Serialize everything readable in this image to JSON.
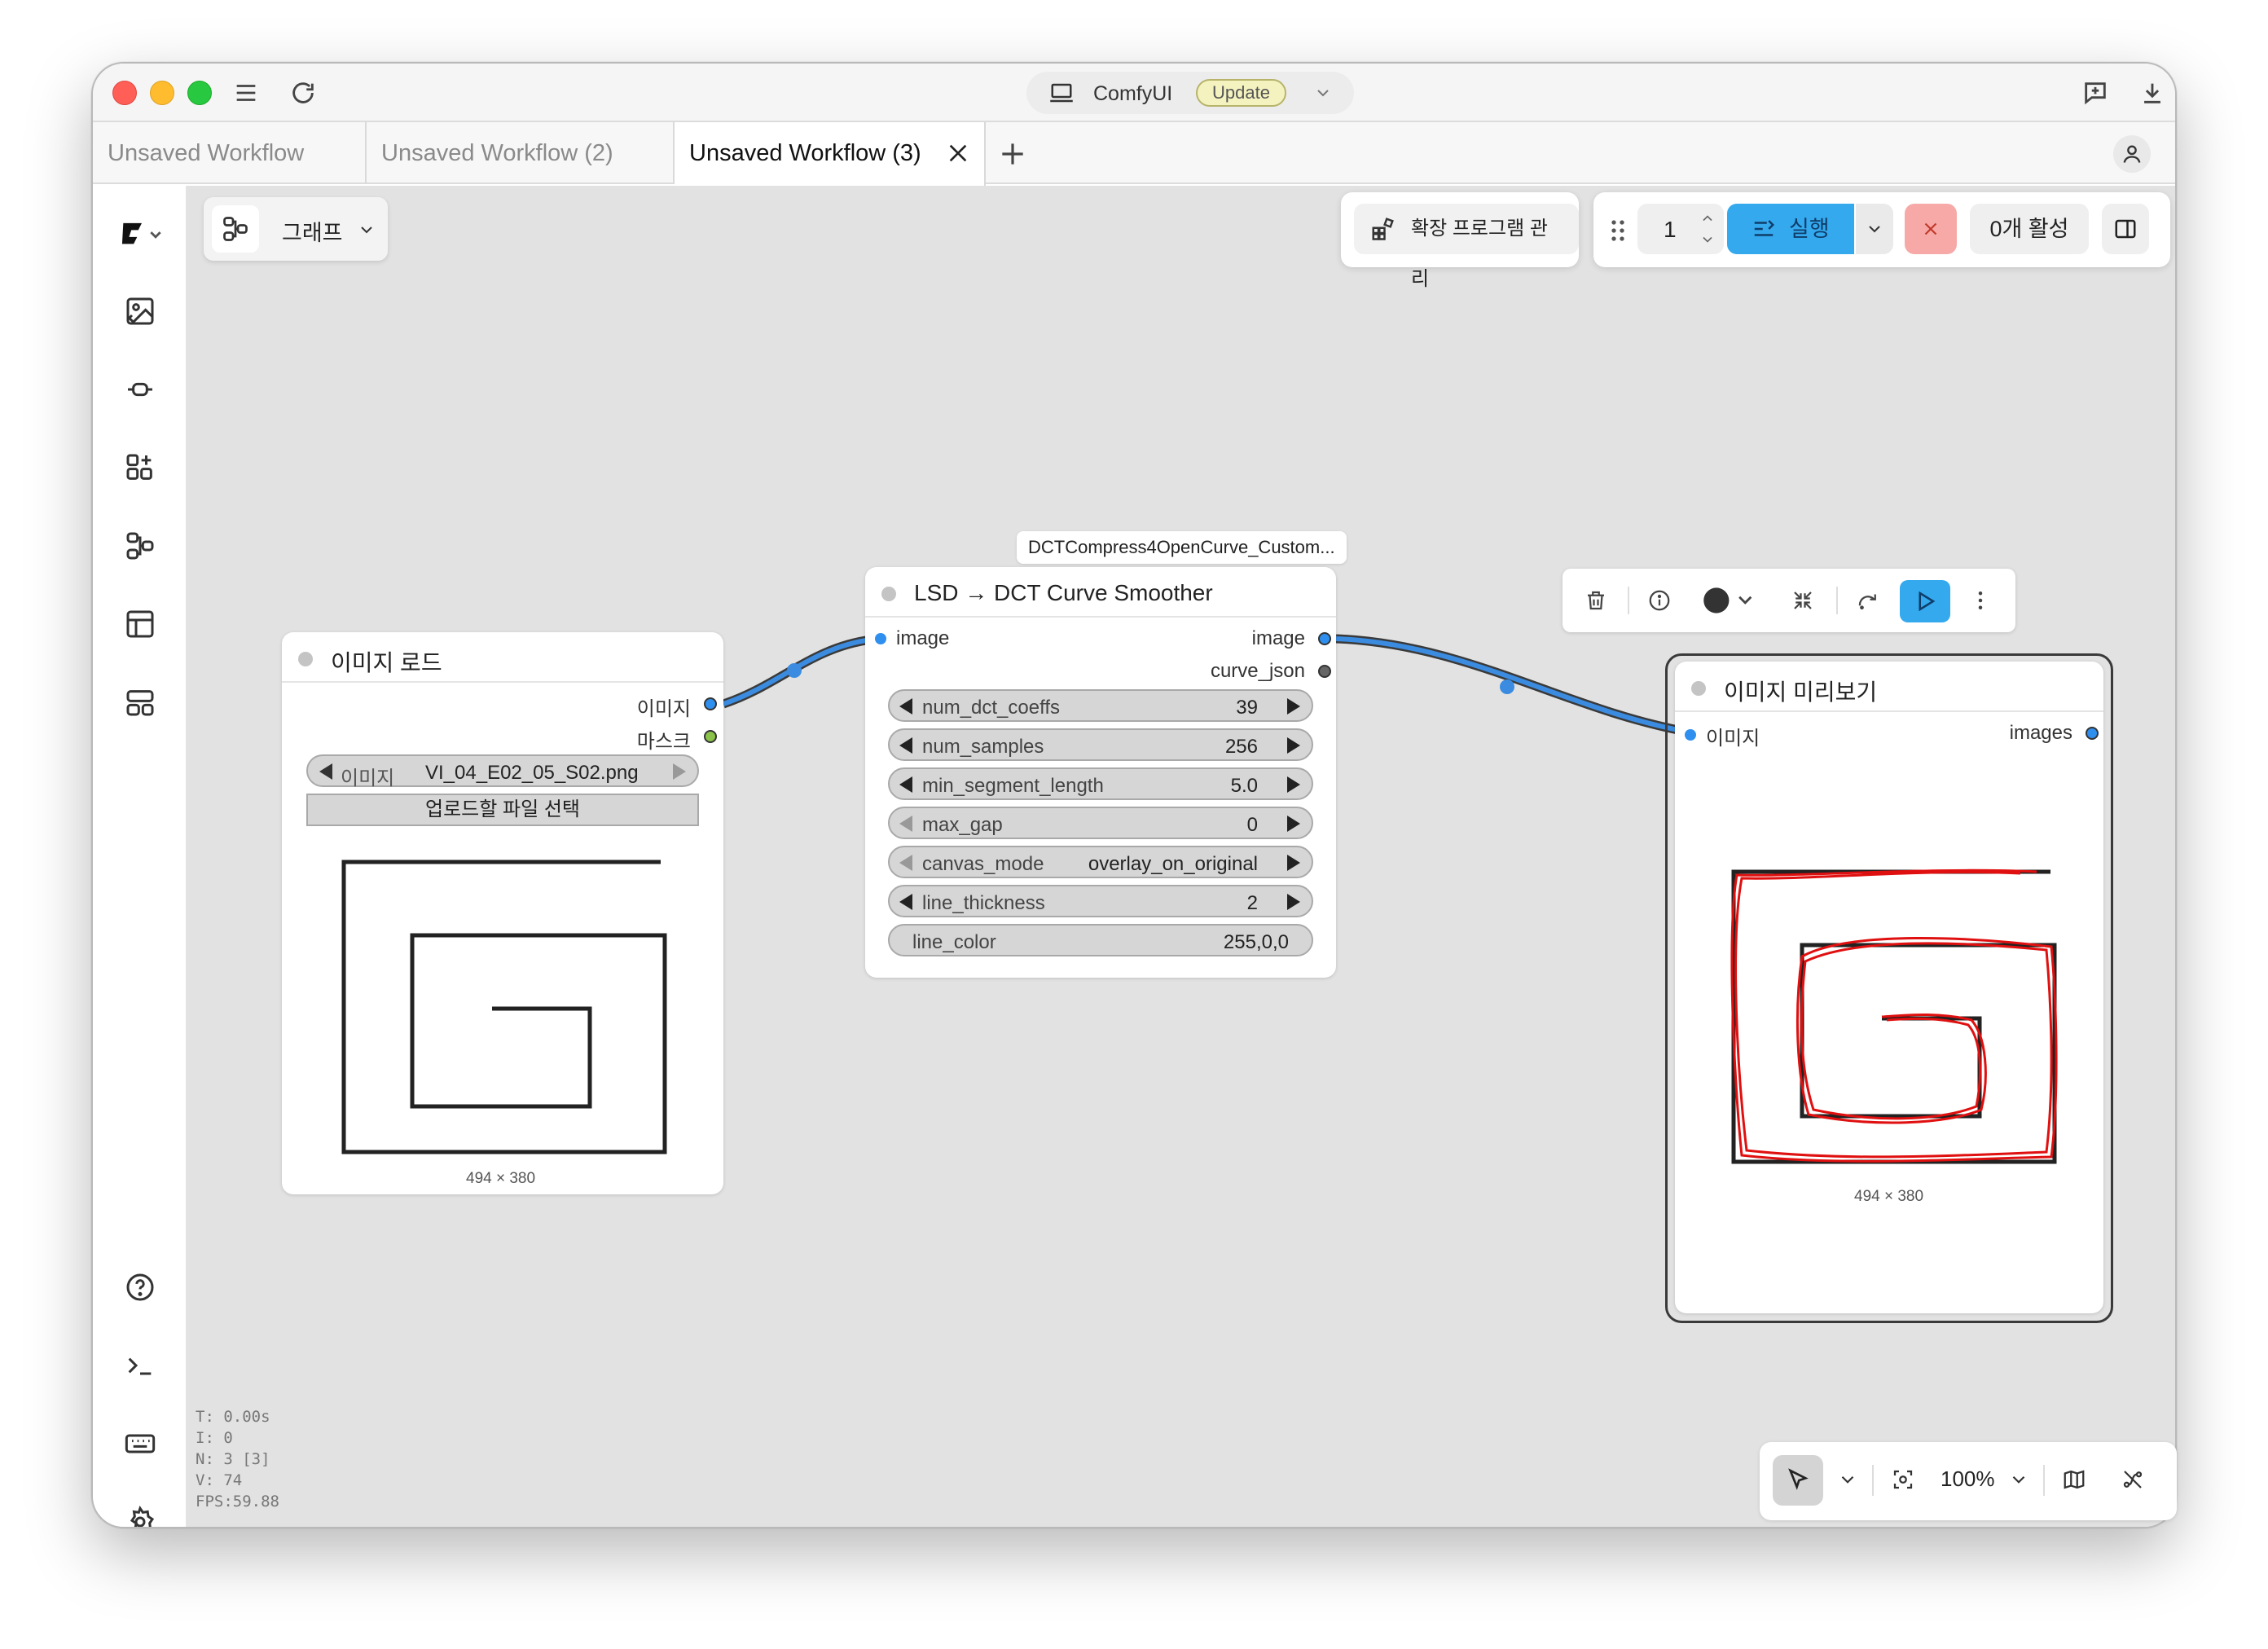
{
  "app": {
    "title": "ComfyUI",
    "update_label": "Update"
  },
  "tabs": [
    {
      "label": "Unsaved Workflow"
    },
    {
      "label": "Unsaved Workflow (2)"
    },
    {
      "label": "Unsaved Workflow (3)",
      "active": true
    }
  ],
  "toolbar": {
    "graph_label": "그래프",
    "extensions_label": "확장 프로그램 관리",
    "queue_count": "1",
    "run_label": "실행",
    "active_label": "0개 활성"
  },
  "nodes": {
    "load_image": {
      "title": "이미지 로드",
      "outputs": [
        "이미지",
        "마스크"
      ],
      "image_widget_label": "이미지",
      "image_widget_value": "VI_04_E02_05_S02.png",
      "upload_label": "업로드할 파일 선택",
      "dimensions": "494 × 380"
    },
    "smoother": {
      "tag": "DCTCompress4OpenCurve_Custom...",
      "title": "LSD → DCT Curve Smoother",
      "input": "image",
      "outputs": [
        "image",
        "curve_json"
      ],
      "widgets": [
        {
          "label": "num_dct_coeffs",
          "value": "39"
        },
        {
          "label": "num_samples",
          "value": "256"
        },
        {
          "label": "min_segment_length",
          "value": "5.0"
        },
        {
          "label": "max_gap",
          "value": "0"
        },
        {
          "label": "canvas_mode",
          "value": "overlay_on_original"
        },
        {
          "label": "line_thickness",
          "value": "2"
        },
        {
          "label": "line_color",
          "value": "255,0,0"
        }
      ]
    },
    "preview": {
      "title": "이미지 미리보기",
      "input": "이미지",
      "output": "images",
      "dimensions": "494 × 380"
    }
  },
  "stats": {
    "t": "T: 0.00s",
    "i": "I: 0",
    "n": "N: 3 [3]",
    "v": "V: 74",
    "fps": "FPS:59.88"
  },
  "canvas_controls": {
    "zoom": "100%"
  },
  "colors": {
    "accent": "#34a9ee",
    "stop": "#f7a9a7",
    "link": "#3b8ce0",
    "curve": "#e01010"
  }
}
